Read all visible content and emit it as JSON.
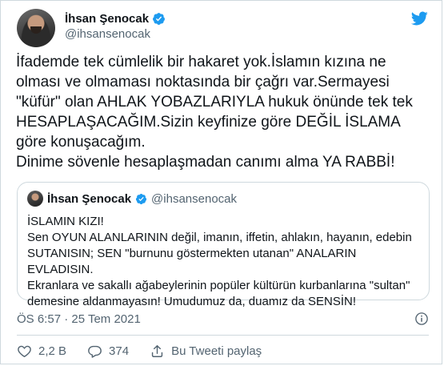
{
  "author": {
    "name": "İhsan Şenocak",
    "handle": "@ihsansenocak"
  },
  "tweet": {
    "text": "İfademde tek cümlelik bir hakaret yok.İslamın kızına ne\nolması ve olmaması noktasında bir çağrı var.Sermayesi\n\"küfür\" olan AHLAK YOBAZLARIYLA hukuk önünde tek tek\nHESAPLAŞACAĞIM.Sizin keyfinize göre DEĞİL İSLAMA\ngöre konuşacağım.\nDinime sövenle hesaplaşmadan canımı alma YA RABBİ!",
    "timestamp": "ÖS 6:57 · 25 Tem 2021"
  },
  "quote": {
    "name": "İhsan Şenocak",
    "handle": "@ihsansenocak",
    "text": "İSLAMIN KIZI!\nSen OYUN ALANLARININ değil, imanın, iffetin, ahlakın, hayanın, edebin\nSUTANISIN; SEN \"burnunu göstermekten utanan\" ANALARIN EVLADISIN.\nEkranlara ve sakallı ağabeylerinin popüler kültürün kurbanlarına \"sultan\"\ndemesine aldanmayasın! Umudumuz da, duamız da SENSİN!"
  },
  "actions": {
    "likes": "2,2 B",
    "replies": "374",
    "share_label": "Bu Tweeti paylaş"
  },
  "colors": {
    "brand": "#1d9bf0",
    "text": "#0f1419",
    "secondary": "#536471",
    "border": "#cfd9de"
  }
}
